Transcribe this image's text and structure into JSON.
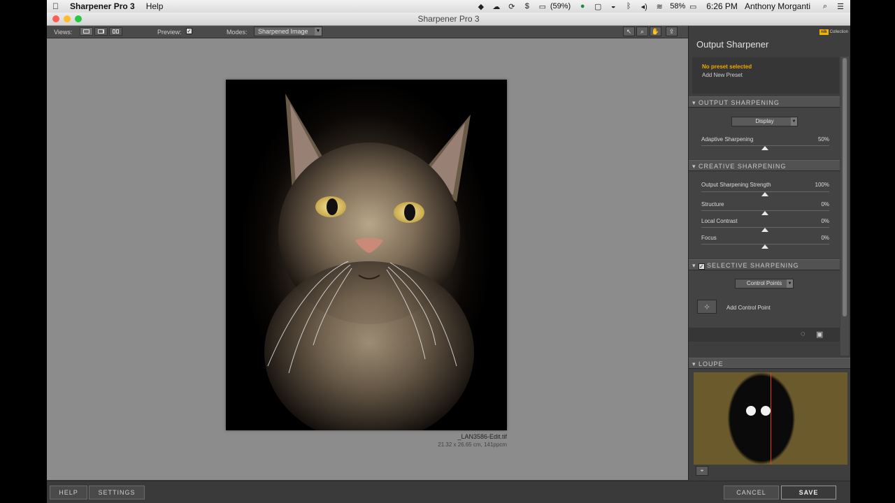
{
  "menubar": {
    "app_name": "Sharpener Pro 3",
    "help": "Help",
    "battery_small": "(59%)",
    "battery": "58%",
    "time": "6:26 PM",
    "user": "Anthony Morganti"
  },
  "window": {
    "title": "Sharpener Pro 3"
  },
  "toolbar": {
    "views_label": "Views:",
    "preview_label": "Preview:",
    "preview_checked": "✓",
    "modes_label": "Modes:",
    "mode_value": "Sharpened Image"
  },
  "canvas": {
    "filename": "_LAN3586-Edit.tif",
    "dimensions": "21.32 x 26.65 cm, 141ppcm"
  },
  "panel": {
    "title": "Output Sharpener",
    "brand": "Collection",
    "brand_badge": "nik",
    "preset_status": "No preset selected",
    "add_preset": "Add New Preset",
    "output_sharpening": {
      "header": "OUTPUT SHARPENING",
      "dropdown": "Display",
      "adaptive_label": "Adaptive Sharpening",
      "adaptive_value": "50%"
    },
    "creative_sharpening": {
      "header": "CREATIVE SHARPENING",
      "rows": [
        {
          "label": "Output Sharpening Strength",
          "value": "100%"
        },
        {
          "label": "Structure",
          "value": "0%"
        },
        {
          "label": "Local Contrast",
          "value": "0%"
        },
        {
          "label": "Focus",
          "value": "0%"
        }
      ]
    },
    "selective_sharpening": {
      "header": "SELECTIVE SHARPENING",
      "dropdown": "Control Points",
      "add_control_point": "Add Control Point"
    },
    "loupe_header": "LOUPE"
  },
  "bottom": {
    "help": "HELP",
    "settings": "SETTINGS",
    "cancel": "CANCEL",
    "save": "SAVE"
  },
  "colors": {
    "accent": "#f0a800",
    "panel": "#3e3e3e",
    "canvas": "#8c8c8c"
  }
}
